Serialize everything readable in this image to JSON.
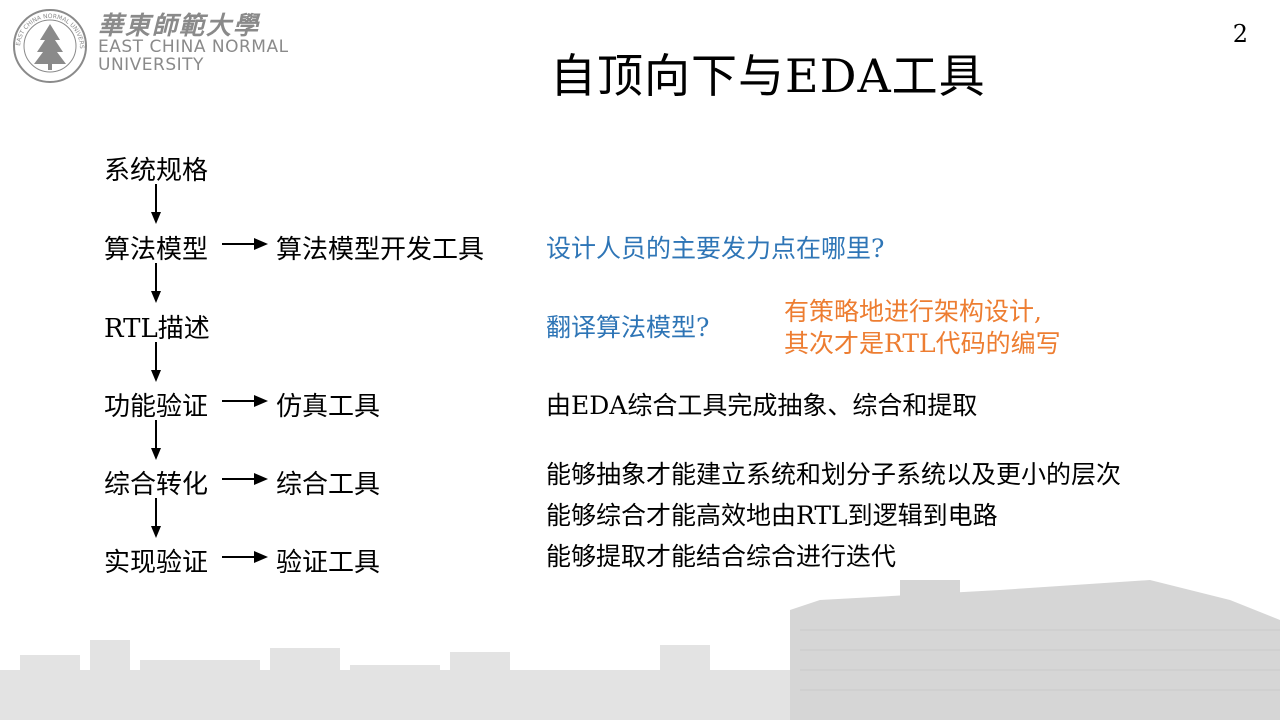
{
  "header": {
    "logo_cn": "華東師範大學",
    "logo_en_line1": "EAST CHINA NORMAL",
    "logo_en_line2": "UNIVERSITY",
    "seal_text": "EAST CHINA NORMAL UNIVERSITY"
  },
  "slide": {
    "page_number": "2",
    "title": "自顶向下与EDA工具"
  },
  "flow": {
    "steps": [
      "系统规格",
      "算法模型",
      "RTL描述",
      "功能验证",
      "综合转化",
      "实现验证"
    ],
    "tools": {
      "algorithm": "算法模型开发工具",
      "verification": "仿真工具",
      "synthesis": "综合工具",
      "implementation": "验证工具"
    }
  },
  "notes": {
    "question1": "设计人员的主要发力点在哪里?",
    "question2": "翻译算法模型?",
    "answer_line1": "有策略地进行架构设计,",
    "answer_line2": "其次才是RTL代码的编写",
    "eda_line": "由EDA综合工具完成抽象、综合和提取",
    "ability1": "能够抽象才能建立系统和划分子系统以及更小的层次",
    "ability2": "能够综合才能高效地由RTL到逻辑到电路",
    "ability3": "能够提取才能结合综合进行迭代"
  },
  "colors": {
    "blue": "#2e75b6",
    "orange": "#ed7d31",
    "logo_gray": "#8a8a8a",
    "skyline_gray": "#d4d4d4"
  }
}
